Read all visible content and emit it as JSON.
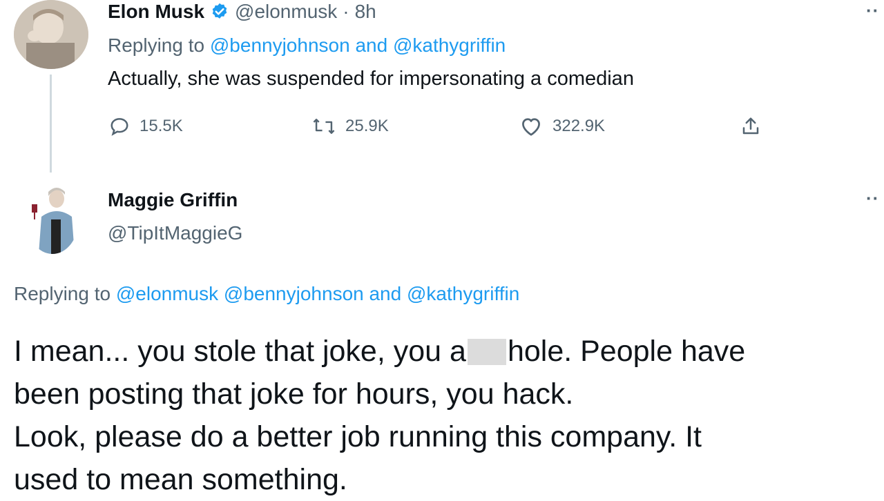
{
  "tweet1": {
    "author_name": "Elon Musk",
    "handle": "@elonmusk",
    "separator": "·",
    "time": "8h",
    "replying_prefix": "Replying to",
    "replying_mentions": "@bennyjohnson and @kathygriffin",
    "text": "Actually, she was suspended for impersonating a comedian",
    "stats": {
      "replies": "15.5K",
      "retweets": "25.9K",
      "likes": "322.9K"
    },
    "icons": [
      "verified-badge-icon",
      "reply-icon",
      "retweet-icon",
      "like-icon",
      "share-icon",
      "more-icon"
    ]
  },
  "tweet2": {
    "author_name": "Maggie Griffin",
    "handle": "@TipItMaggieG",
    "replying_prefix": "Replying to",
    "replying_mentions": "@elonmusk @bennyjohnson and @kathygriffin",
    "text_line1_a": "I mean... you stole that joke, you a",
    "text_line1_b": "hole. People have",
    "text_line2": "been posting that joke for hours, you hack.",
    "text_line3": "Look, please do a better job running this company. It",
    "text_line4": "used to mean something."
  },
  "colors": {
    "accent": "#1d9bf0",
    "secondary_text": "#536471",
    "primary_text": "#0f1419",
    "thread_line": "#cfd9de"
  }
}
